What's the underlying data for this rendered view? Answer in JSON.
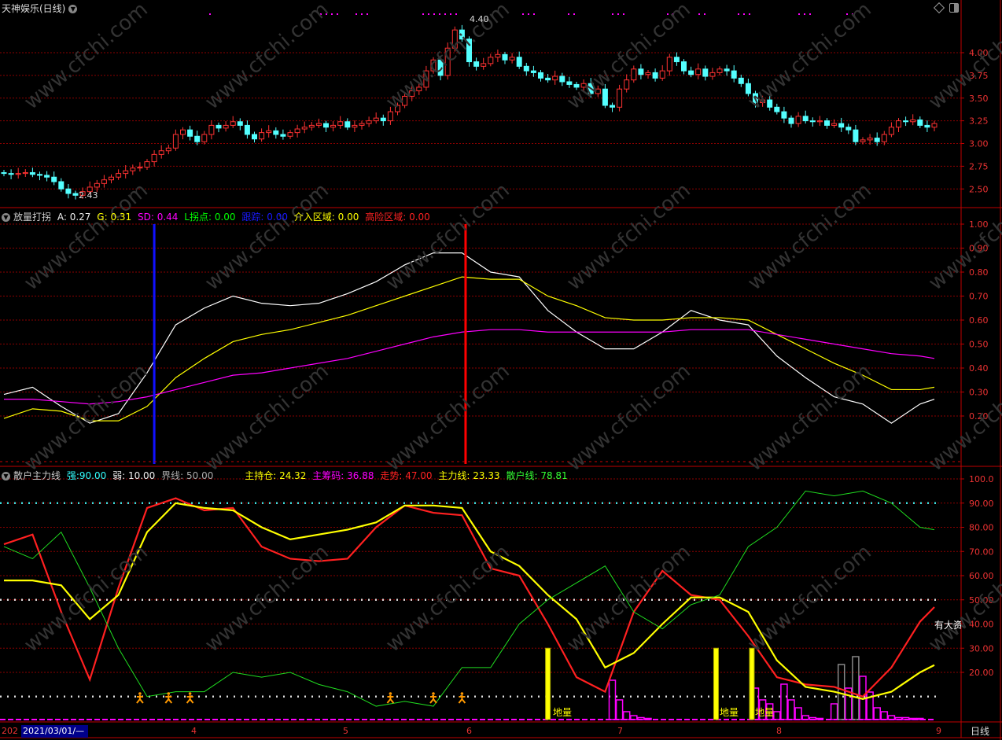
{
  "header": {
    "title": "天神娱乐(日线)",
    "high_label": "4.40",
    "low_label": "2.43"
  },
  "panel2": {
    "name": "放量打拐",
    "a_label": "A:",
    "a": "0.27",
    "g_label": "G:",
    "g": "0.31",
    "sd_label": "SD:",
    "sd": "0.44",
    "l_label": "L拐点:",
    "l": "0.00",
    "track_label": "跟踪:",
    "track": "0.00",
    "entry_label": "介入区域:",
    "entry": "0.00",
    "risk_label": "高险区域:",
    "risk": "0.00"
  },
  "panel3": {
    "name": "散户主力线",
    "strong_label": "强:",
    "strong": "90.00",
    "weak_label": "弱:",
    "weak": "10.00",
    "bound_label": "界线:",
    "bound": "50.00",
    "hold_label": "主持仓:",
    "hold": "24.32",
    "chip_label": "主筹码:",
    "chip": "36.88",
    "trend_label": "走势:",
    "trend": "47.00",
    "main_label": "主力线:",
    "main": "23.33",
    "retail_label": "散户线:",
    "retail": "78.81",
    "signal_text": "地量",
    "right_note": "有大资"
  },
  "time_axis": {
    "year_stub": "202",
    "cursor_date": "2021/03/01/—",
    "months": [
      "4",
      "5",
      "6",
      "7",
      "8",
      "9"
    ],
    "period": "日线"
  },
  "colors": {
    "up": "#ff3232",
    "down": "#54ffff",
    "grid": "#8b0000"
  },
  "chart_data": [
    {
      "type": "candlestick",
      "title": "天神娱乐(日线)",
      "yticks": [
        "4.00",
        "3.75",
        "3.50",
        "3.25",
        "3.00",
        "2.75",
        "2.50"
      ],
      "ylim": [
        2.35,
        4.45
      ],
      "close": [
        2.67,
        2.66,
        2.67,
        2.68,
        2.66,
        2.65,
        2.63,
        2.58,
        2.5,
        2.45,
        2.43,
        2.47,
        2.52,
        2.56,
        2.6,
        2.63,
        2.67,
        2.7,
        2.73,
        2.74,
        2.8,
        2.88,
        2.92,
        2.95,
        3.1,
        3.15,
        3.08,
        3.02,
        3.1,
        3.2,
        3.17,
        3.2,
        3.24,
        3.2,
        3.1,
        3.05,
        3.12,
        3.14,
        3.1,
        3.08,
        3.12,
        3.16,
        3.18,
        3.2,
        3.22,
        3.18,
        3.2,
        3.24,
        3.18,
        3.2,
        3.22,
        3.25,
        3.28,
        3.25,
        3.35,
        3.42,
        3.52,
        3.58,
        3.62,
        3.8,
        3.92,
        3.75,
        4.05,
        4.25,
        4.15,
        3.9,
        3.85,
        3.88,
        3.95,
        3.98,
        3.92,
        3.95,
        3.85,
        3.8,
        3.78,
        3.72,
        3.7,
        3.74,
        3.68,
        3.65,
        3.62,
        3.66,
        3.55,
        3.6,
        3.42,
        3.4,
        3.6,
        3.7,
        3.82,
        3.76,
        3.78,
        3.72,
        3.8,
        3.95,
        3.9,
        3.8,
        3.76,
        3.82,
        3.74,
        3.78,
        3.82,
        3.8,
        3.72,
        3.66,
        3.55,
        3.45,
        3.48,
        3.4,
        3.35,
        3.28,
        3.22,
        3.3,
        3.25,
        3.24,
        3.25,
        3.2,
        3.22,
        3.18,
        3.15,
        3.02,
        3.04,
        3.06,
        3.02,
        3.1,
        3.18,
        3.25,
        3.24,
        3.26,
        3.2,
        3.18,
        3.22
      ]
    },
    {
      "type": "line",
      "title": "放量打拐",
      "yticks": [
        "1.00",
        "0.90",
        "0.80",
        "0.70",
        "0.60",
        "0.50",
        "0.40",
        "0.30",
        "0.20"
      ],
      "ylim": [
        0.0,
        1.0
      ],
      "x": [
        0,
        4,
        8,
        12,
        16,
        20,
        24,
        28,
        32,
        36,
        40,
        44,
        48,
        52,
        56,
        60,
        64,
        68,
        72,
        76,
        80,
        84,
        88,
        92,
        96,
        100,
        104,
        108,
        112,
        116,
        120,
        124,
        128,
        130
      ],
      "series": [
        {
          "name": "A",
          "color": "#ffffff",
          "values": [
            0.29,
            0.32,
            0.24,
            0.17,
            0.21,
            0.38,
            0.58,
            0.65,
            0.7,
            0.67,
            0.66,
            0.67,
            0.71,
            0.76,
            0.83,
            0.88,
            0.88,
            0.8,
            0.78,
            0.64,
            0.55,
            0.48,
            0.48,
            0.55,
            0.64,
            0.6,
            0.58,
            0.45,
            0.36,
            0.28,
            0.25,
            0.17,
            0.25,
            0.27
          ]
        },
        {
          "name": "G",
          "color": "#ffff00",
          "values": [
            0.19,
            0.23,
            0.22,
            0.18,
            0.18,
            0.24,
            0.36,
            0.44,
            0.51,
            0.54,
            0.56,
            0.59,
            0.62,
            0.66,
            0.7,
            0.74,
            0.78,
            0.77,
            0.77,
            0.7,
            0.66,
            0.61,
            0.6,
            0.6,
            0.61,
            0.61,
            0.6,
            0.54,
            0.48,
            0.42,
            0.37,
            0.31,
            0.31,
            0.32
          ]
        },
        {
          "name": "SD",
          "color": "#ff00ff",
          "values": [
            0.27,
            0.27,
            0.26,
            0.25,
            0.26,
            0.28,
            0.31,
            0.34,
            0.37,
            0.38,
            0.4,
            0.42,
            0.44,
            0.47,
            0.5,
            0.53,
            0.55,
            0.56,
            0.56,
            0.55,
            0.55,
            0.55,
            0.55,
            0.55,
            0.56,
            0.56,
            0.56,
            0.54,
            0.52,
            0.5,
            0.48,
            0.46,
            0.45,
            0.44
          ]
        }
      ],
      "vlines": [
        {
          "x": 21,
          "color": "#1010ff"
        },
        {
          "x": 64.5,
          "color": "#ff0000"
        }
      ]
    },
    {
      "type": "line",
      "title": "散户主力线",
      "yticks": [
        "100.0",
        "90.00",
        "80.00",
        "70.00",
        "60.00",
        "50.00",
        "40.00",
        "30.00",
        "20.00"
      ],
      "ylim": [
        0,
        105
      ],
      "x": [
        0,
        4,
        8,
        12,
        16,
        20,
        24,
        28,
        32,
        36,
        40,
        44,
        48,
        52,
        56,
        60,
        64,
        68,
        72,
        76,
        80,
        84,
        88,
        92,
        96,
        100,
        104,
        108,
        112,
        116,
        120,
        124,
        128,
        130
      ],
      "series": [
        {
          "name": "走势",
          "color": "#ff2020",
          "values": [
            73,
            77,
            45,
            17,
            55,
            88,
            92,
            87,
            88,
            72,
            67,
            66,
            67,
            80,
            89,
            86,
            85,
            63,
            60,
            40,
            18,
            12,
            45,
            62,
            52,
            50,
            35,
            18,
            15,
            14,
            10,
            22,
            41,
            47
          ]
        },
        {
          "name": "主力线",
          "color": "#ffff00",
          "values": [
            58,
            58,
            56,
            42,
            52,
            78,
            90,
            88,
            87,
            80,
            75,
            77,
            79,
            82,
            89,
            89,
            88,
            70,
            64,
            52,
            42,
            22,
            28,
            40,
            51,
            51,
            45,
            25,
            14,
            12,
            9,
            12,
            20,
            23
          ]
        },
        {
          "name": "散户线",
          "color": "#20dd20",
          "values": [
            72,
            67,
            78,
            55,
            30,
            10,
            12,
            12,
            20,
            18,
            20,
            15,
            12,
            6,
            8,
            6,
            22,
            22,
            40,
            50,
            57,
            64,
            45,
            38,
            48,
            52,
            72,
            80,
            95,
            93,
            95,
            90,
            80,
            79
          ]
        }
      ],
      "hlines": [
        {
          "value": 90,
          "color": "#40e0e0"
        },
        {
          "value": 50,
          "color": "#dddddd"
        },
        {
          "value": 10,
          "color": "#dddddd"
        }
      ],
      "signal_bars": [
        76,
        99.5,
        104.5
      ],
      "runner_marks": [
        19,
        23,
        26,
        54,
        60,
        64
      ],
      "volume_bars": {
        "x": [
          85,
          86,
          87,
          88,
          89,
          90,
          105,
          106,
          107,
          108,
          109,
          110,
          111,
          112,
          113,
          114,
          116,
          117,
          118,
          119,
          120,
          121,
          122,
          123,
          124,
          125,
          126,
          127,
          128
        ],
        "values": [
          10,
          5,
          2,
          1,
          0.5,
          0.3,
          8,
          5,
          4,
          2,
          9,
          5,
          3,
          1,
          0.5,
          0.3,
          4,
          14,
          8,
          16,
          11,
          7,
          3,
          2,
          1,
          0.5,
          0.5,
          0.3,
          0.3
        ]
      }
    }
  ]
}
